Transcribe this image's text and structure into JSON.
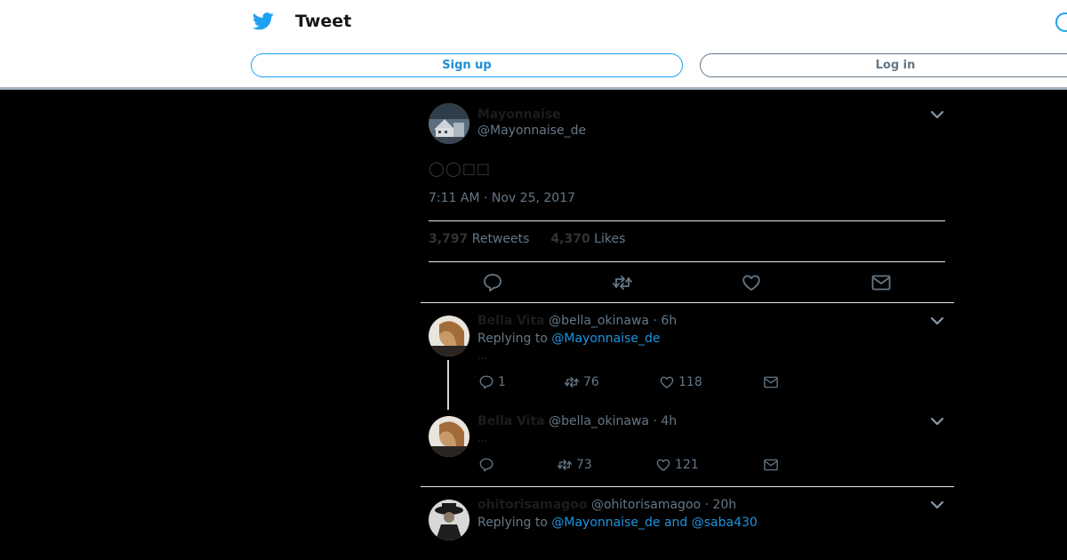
{
  "header": {
    "title": "Tweet",
    "signup_label": "Sign up",
    "login_label": "Log in"
  },
  "tweet": {
    "name": "Mayonnaise",
    "handle": "@Mayonnaise_de",
    "text": "◯◯□□",
    "timestamp": "7:11 AM · Nov 25, 2017",
    "retweets_count": "3,797",
    "retweets_label": "Retweets",
    "likes_count": "4,370",
    "likes_label": "Likes"
  },
  "replies": [
    {
      "name": "Bella Vita",
      "handle": "@bella_okinawa",
      "time": "· 6h",
      "replying_prefix": "Replying to",
      "replying_to": "@Mayonnaise_de",
      "text": "...",
      "reply_count": "1",
      "retweet_count": "76",
      "like_count": "118"
    },
    {
      "name": "Bella Vita",
      "handle": "@bella_okinawa",
      "time": "· 4h",
      "text": "...",
      "reply_count": "",
      "retweet_count": "73",
      "like_count": "121"
    },
    {
      "name": "ohitorisamagoo",
      "handle": "@ohitorisamagoo",
      "time": "· 20h",
      "replying_prefix": "Replying to",
      "replying_to": "@Mayonnaise_de and @saba430"
    }
  ],
  "icons": {
    "logo": "twitter-bird-icon",
    "search": "search-icon",
    "reply": "reply-icon",
    "retweet": "retweet-icon",
    "like": "heart-icon",
    "dm": "envelope-icon",
    "more": "chevron-down-icon"
  },
  "colors": {
    "accent": "#1da1f2",
    "link": "#1b95e0",
    "background": "#000000",
    "muted": "#657786"
  }
}
